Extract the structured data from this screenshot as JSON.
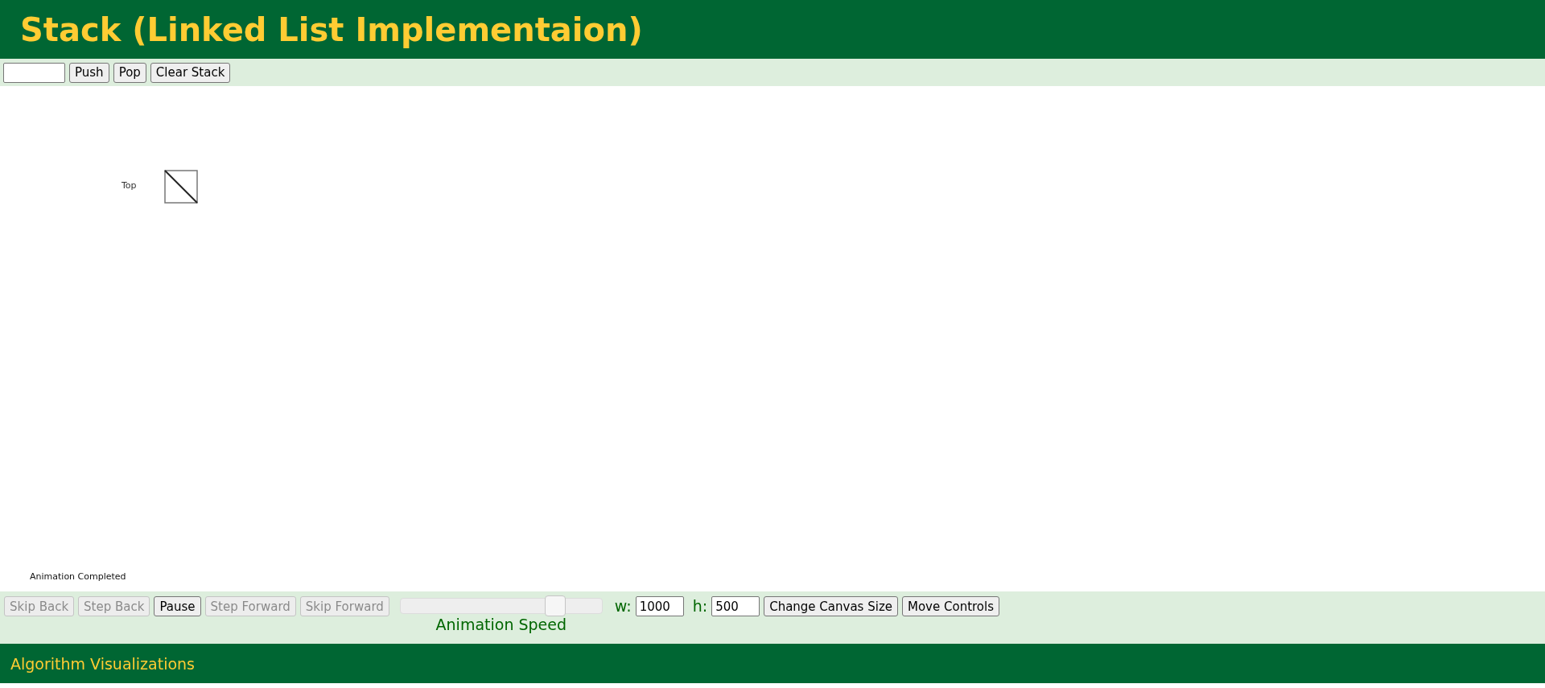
{
  "header": {
    "title": "Stack (Linked List Implementaion)"
  },
  "toolbar": {
    "buttons": [
      {
        "label": "Push"
      },
      {
        "label": "Pop"
      },
      {
        "label": "Clear Stack"
      }
    ]
  },
  "canvas": {
    "top_label": "Top",
    "status": "Animation Completed"
  },
  "controls": {
    "buttons": [
      {
        "label": "Skip Back",
        "disabled": true
      },
      {
        "label": "Step Back",
        "disabled": true
      },
      {
        "label": "Pause",
        "disabled": false
      },
      {
        "label": "Step Forward",
        "disabled": true
      },
      {
        "label": "Skip Forward",
        "disabled": true
      }
    ],
    "speed": {
      "label": "Animation Speed",
      "level": 0.77
    },
    "width": {
      "label": "w:",
      "value": "1000"
    },
    "height": {
      "label": "h:",
      "value": "500"
    },
    "actions": [
      {
        "label": "Change Canvas Size"
      },
      {
        "label": "Move Controls"
      }
    ]
  },
  "footer": {
    "title": "Algorithm Visualizations"
  }
}
